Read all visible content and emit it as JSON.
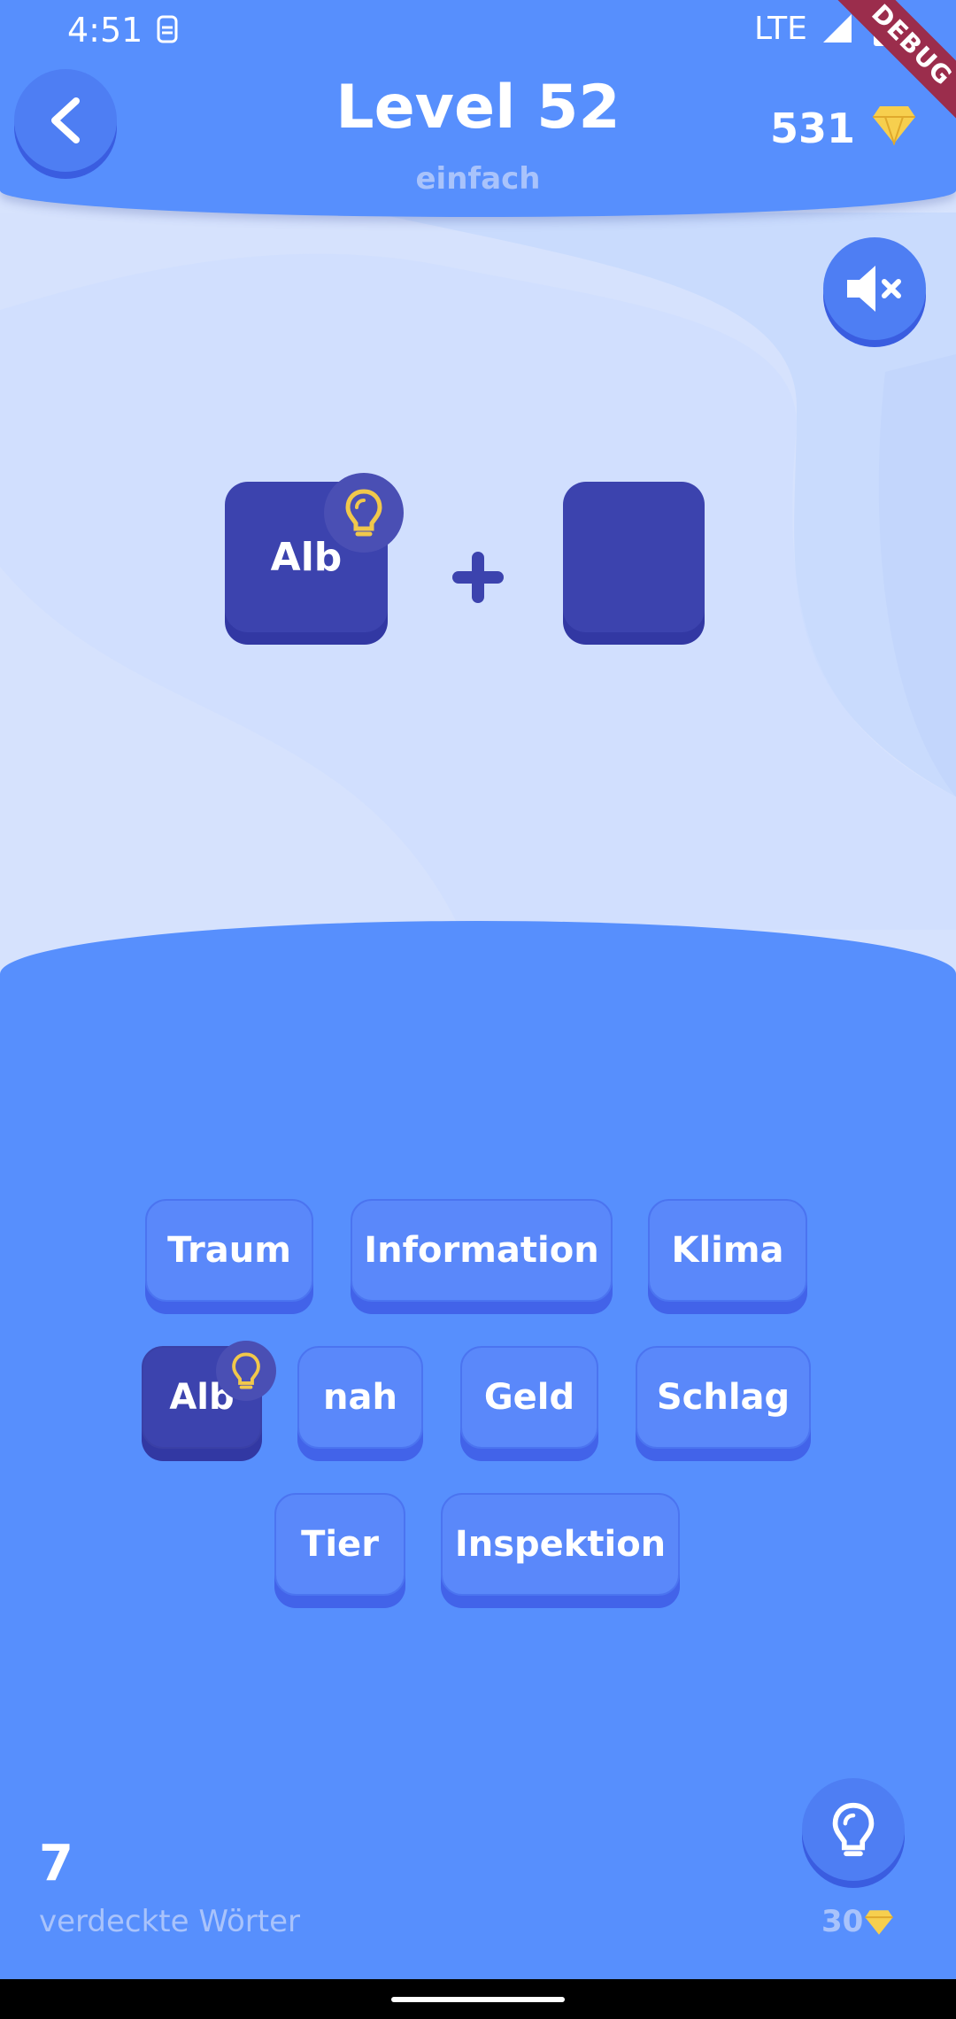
{
  "status_bar": {
    "time": "4:51",
    "network": "LTE",
    "debug_label": "DEBUG"
  },
  "header": {
    "title": "Level 52",
    "subtitle": "einfach",
    "gems": "531"
  },
  "puzzle": {
    "slot1": "Alb",
    "slot2": "",
    "operator": "+"
  },
  "words": [
    "Traum",
    "Information",
    "Klima",
    "Alb",
    "nah",
    "Geld",
    "Schlag",
    "Tier",
    "Inspektion"
  ],
  "footer": {
    "hidden_count": "7",
    "hidden_label": "verdeckte Wörter",
    "hint_cost": "30"
  },
  "colors": {
    "primary": "#578ffd",
    "tile": "#3c43ae",
    "gem": "#f7cf4e",
    "bulb": "#f1c84b"
  },
  "icons": [
    "back-arrow-icon",
    "diamond-icon",
    "mute-icon",
    "lightbulb-icon",
    "plus-icon"
  ]
}
